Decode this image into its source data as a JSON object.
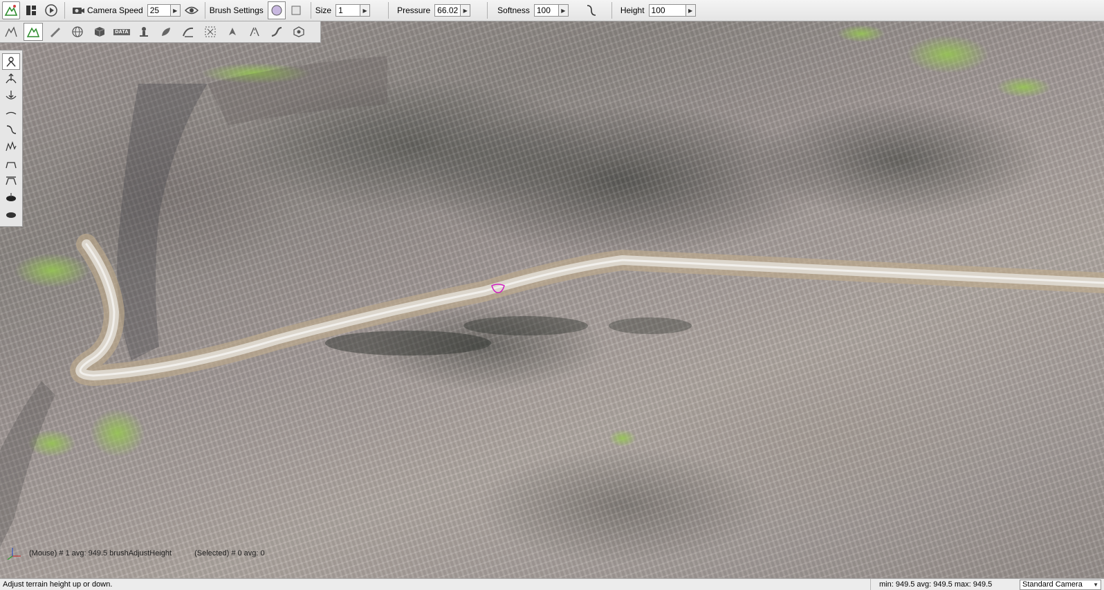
{
  "toolbar": {
    "camera_speed_label": "Camera Speed",
    "camera_speed_value": "25",
    "brush_settings_label": "Brush Settings",
    "size_label": "Size",
    "size_value": "1",
    "pressure_label": "Pressure",
    "pressure_value": "66.029",
    "softness_label": "Softness",
    "softness_value": "100",
    "height_label": "Height",
    "height_value": "100",
    "brush_shape_selected": "circle"
  },
  "modebar": {
    "data_icon_text": "DATA",
    "active_mode": "terrain-height-tool"
  },
  "palette": {
    "active_tool": "adjust-height-brush"
  },
  "viewport": {
    "mouse_info": "(Mouse) # 1  avg: 949.5  brushAdjustHeight",
    "selected_info": "(Selected) # 0  avg: 0"
  },
  "statusbar": {
    "hint": "Adjust terrain height up or down.",
    "stats": "min: 949.5  avg: 949.5  max: 949.5",
    "camera": "Standard Camera"
  },
  "colors": {
    "toolbar_bg": "#e8e8e8",
    "road": "#d9d4cc",
    "brush_cursor": "#d020c0",
    "grass": "#9cc850"
  }
}
